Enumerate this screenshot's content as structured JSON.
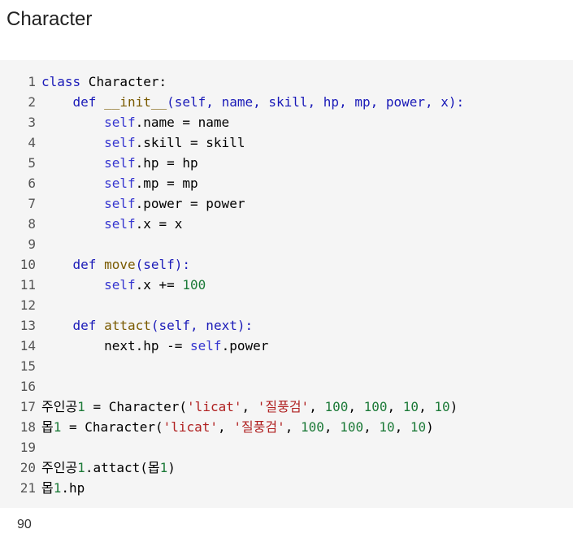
{
  "page": {
    "title": "Character"
  },
  "colors": {
    "keyword": "#1a1ab8",
    "self": "#3535d0",
    "function": "#7a5a00",
    "string": "#b02020",
    "number": "#1c7a38",
    "code_background": "#f5f5f5"
  },
  "code": {
    "lines": [
      {
        "num": "1",
        "tokens": [
          {
            "t": "kw",
            "v": "class"
          },
          {
            "t": "t",
            "v": " Character:"
          }
        ]
      },
      {
        "num": "2",
        "tokens": [
          {
            "t": "t",
            "v": "    "
          },
          {
            "t": "kw",
            "v": "def"
          },
          {
            "t": "t",
            "v": " "
          },
          {
            "t": "fn",
            "v": "__init__"
          },
          {
            "t": "p",
            "v": "(self, name, skill, hp, mp, power, x):"
          }
        ]
      },
      {
        "num": "3",
        "tokens": [
          {
            "t": "t",
            "v": "        "
          },
          {
            "t": "self",
            "v": "self"
          },
          {
            "t": "t",
            "v": ".name = name"
          }
        ]
      },
      {
        "num": "4",
        "tokens": [
          {
            "t": "t",
            "v": "        "
          },
          {
            "t": "self",
            "v": "self"
          },
          {
            "t": "t",
            "v": ".skill = skill"
          }
        ]
      },
      {
        "num": "5",
        "tokens": [
          {
            "t": "t",
            "v": "        "
          },
          {
            "t": "self",
            "v": "self"
          },
          {
            "t": "t",
            "v": ".hp = hp"
          }
        ]
      },
      {
        "num": "6",
        "tokens": [
          {
            "t": "t",
            "v": "        "
          },
          {
            "t": "self",
            "v": "self"
          },
          {
            "t": "t",
            "v": ".mp = mp"
          }
        ]
      },
      {
        "num": "7",
        "tokens": [
          {
            "t": "t",
            "v": "        "
          },
          {
            "t": "self",
            "v": "self"
          },
          {
            "t": "t",
            "v": ".power = power"
          }
        ]
      },
      {
        "num": "8",
        "tokens": [
          {
            "t": "t",
            "v": "        "
          },
          {
            "t": "self",
            "v": "self"
          },
          {
            "t": "t",
            "v": ".x = x"
          }
        ]
      },
      {
        "num": "9",
        "tokens": []
      },
      {
        "num": "10",
        "tokens": [
          {
            "t": "t",
            "v": "    "
          },
          {
            "t": "kw",
            "v": "def"
          },
          {
            "t": "t",
            "v": " "
          },
          {
            "t": "fn",
            "v": "move"
          },
          {
            "t": "p",
            "v": "(self):"
          }
        ]
      },
      {
        "num": "11",
        "tokens": [
          {
            "t": "t",
            "v": "        "
          },
          {
            "t": "self",
            "v": "self"
          },
          {
            "t": "t",
            "v": ".x += "
          },
          {
            "t": "num",
            "v": "100"
          }
        ]
      },
      {
        "num": "12",
        "tokens": []
      },
      {
        "num": "13",
        "tokens": [
          {
            "t": "t",
            "v": "    "
          },
          {
            "t": "kw",
            "v": "def"
          },
          {
            "t": "t",
            "v": " "
          },
          {
            "t": "fn",
            "v": "attact"
          },
          {
            "t": "p",
            "v": "(self, next):"
          }
        ]
      },
      {
        "num": "14",
        "tokens": [
          {
            "t": "t",
            "v": "        next.hp -= "
          },
          {
            "t": "self",
            "v": "self"
          },
          {
            "t": "t",
            "v": ".power"
          }
        ]
      },
      {
        "num": "15",
        "tokens": []
      },
      {
        "num": "16",
        "tokens": []
      },
      {
        "num": "17",
        "tokens": [
          {
            "t": "t",
            "v": "주인공"
          },
          {
            "t": "num",
            "v": "1"
          },
          {
            "t": "t",
            "v": " = Character("
          },
          {
            "t": "str",
            "v": "'licat'"
          },
          {
            "t": "t",
            "v": ", "
          },
          {
            "t": "str",
            "v": "'질풍검'"
          },
          {
            "t": "t",
            "v": ", "
          },
          {
            "t": "num",
            "v": "100"
          },
          {
            "t": "t",
            "v": ", "
          },
          {
            "t": "num",
            "v": "100"
          },
          {
            "t": "t",
            "v": ", "
          },
          {
            "t": "num",
            "v": "10"
          },
          {
            "t": "t",
            "v": ", "
          },
          {
            "t": "num",
            "v": "10"
          },
          {
            "t": "t",
            "v": ")"
          }
        ]
      },
      {
        "num": "18",
        "tokens": [
          {
            "t": "t",
            "v": "몹"
          },
          {
            "t": "num",
            "v": "1"
          },
          {
            "t": "t",
            "v": " = Character("
          },
          {
            "t": "str",
            "v": "'licat'"
          },
          {
            "t": "t",
            "v": ", "
          },
          {
            "t": "str",
            "v": "'질풍검'"
          },
          {
            "t": "t",
            "v": ", "
          },
          {
            "t": "num",
            "v": "100"
          },
          {
            "t": "t",
            "v": ", "
          },
          {
            "t": "num",
            "v": "100"
          },
          {
            "t": "t",
            "v": ", "
          },
          {
            "t": "num",
            "v": "10"
          },
          {
            "t": "t",
            "v": ", "
          },
          {
            "t": "num",
            "v": "10"
          },
          {
            "t": "t",
            "v": ")"
          }
        ]
      },
      {
        "num": "19",
        "tokens": []
      },
      {
        "num": "20",
        "tokens": [
          {
            "t": "t",
            "v": "주인공"
          },
          {
            "t": "num",
            "v": "1"
          },
          {
            "t": "t",
            "v": ".attact(몹"
          },
          {
            "t": "num",
            "v": "1"
          },
          {
            "t": "t",
            "v": ")"
          }
        ]
      },
      {
        "num": "21",
        "tokens": [
          {
            "t": "t",
            "v": "몹"
          },
          {
            "t": "num",
            "v": "1"
          },
          {
            "t": "t",
            "v": ".hp"
          }
        ]
      }
    ]
  },
  "output": {
    "text": "90"
  }
}
